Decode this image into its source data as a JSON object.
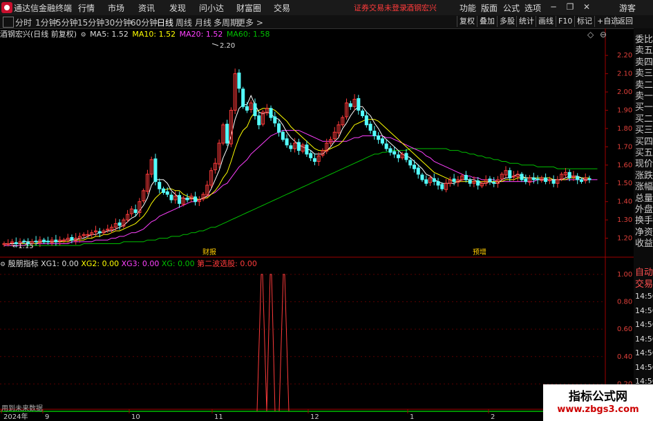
{
  "menubar": {
    "app_name": "通达信金融终端",
    "menus": [
      "行情",
      "市场",
      "资讯",
      "发现",
      "问小达",
      "财富圈",
      "交易"
    ],
    "warning": "证券交易未登录",
    "stock_link": "酒钢宏兴",
    "tools": [
      "功能",
      "版面",
      "公式",
      "选项"
    ],
    "user": "游客"
  },
  "toolbar": {
    "periods": [
      "分时",
      "1分钟",
      "5分钟",
      "15分钟",
      "30分钟",
      "60分钟",
      "日线",
      "周线",
      "月线",
      "多周期",
      "更多 >"
    ],
    "active_period": "日线",
    "right_buttons": [
      "复权",
      "叠加",
      "多股",
      "统计",
      "画线",
      "F10",
      "标记",
      "+自选",
      "返回"
    ]
  },
  "chart_header": {
    "stock": "酒钢宏兴(日线 前复权)",
    "ma5": "MA5: 1.52",
    "ma10": "MA10: 1.52",
    "ma20": "MA20: 1.52",
    "ma60": "MA60: 1.58"
  },
  "indicator_header": {
    "name": "殷朋指标",
    "xg1": "XG1: 0.00",
    "xg2": "XG2: 0.00",
    "xg3": "XG3: 0.00",
    "xg": "XG: 0.00",
    "second": "第二波选股: 0.00"
  },
  "colors": {
    "up": "#ff3b3b",
    "down": "#54ffff",
    "ma5": "#ffffff",
    "ma10": "#ffff00",
    "ma20": "#ff40ff",
    "ma60": "#00c000",
    "grid": "#7a0000"
  },
  "chart_data": {
    "type": "candlestick",
    "y_range": [
      1.1,
      2.28
    ],
    "y_ticks": [
      "2.20",
      "2.10",
      "2.00",
      "1.90",
      "1.80",
      "1.70",
      "1.60",
      "1.50",
      "1.40",
      "1.30",
      "1.20"
    ],
    "high_label": "2.20",
    "low_label": "1.15",
    "x_labels": [
      "2024年",
      "9",
      "10",
      "11",
      "12",
      "1",
      "2"
    ],
    "event_labels": [
      "财报",
      "预增"
    ],
    "indicator_range": [
      0,
      1.05
    ],
    "indicator_ticks": [
      "1.00",
      "0.80",
      "0.60",
      "0.40",
      "0.20"
    ],
    "closes": [
      1.17,
      1.17,
      1.18,
      1.17,
      1.18,
      1.18,
      1.17,
      1.18,
      1.18,
      1.19,
      1.18,
      1.18,
      1.19,
      1.18,
      1.19,
      1.19,
      1.2,
      1.19,
      1.2,
      1.21,
      1.22,
      1.22,
      1.23,
      1.24,
      1.23,
      1.24,
      1.25,
      1.26,
      1.28,
      1.27,
      1.3,
      1.33,
      1.36,
      1.34,
      1.4,
      1.46,
      1.55,
      1.63,
      1.51,
      1.47,
      1.45,
      1.44,
      1.41,
      1.43,
      1.39,
      1.42,
      1.41,
      1.43,
      1.4,
      1.41,
      1.44,
      1.49,
      1.57,
      1.61,
      1.72,
      1.82,
      1.72,
      1.9,
      2.1,
      2.02,
      1.92,
      1.9,
      1.94,
      1.87,
      1.82,
      1.89,
      1.91,
      1.86,
      1.83,
      1.78,
      1.74,
      1.71,
      1.69,
      1.72,
      1.68,
      1.71,
      1.66,
      1.64,
      1.62,
      1.65,
      1.68,
      1.72,
      1.74,
      1.78,
      1.82,
      1.86,
      1.94,
      1.92,
      1.96,
      1.9,
      1.87,
      1.82,
      1.79,
      1.76,
      1.74,
      1.72,
      1.69,
      1.67,
      1.66,
      1.64,
      1.66,
      1.63,
      1.6,
      1.58,
      1.55,
      1.52,
      1.5,
      1.53,
      1.51,
      1.49,
      1.47,
      1.5,
      1.52,
      1.51,
      1.52,
      1.54,
      1.52,
      1.5,
      1.51,
      1.49,
      1.5,
      1.52,
      1.51,
      1.5,
      1.52,
      1.55,
      1.57,
      1.53,
      1.54,
      1.55,
      1.52,
      1.51,
      1.53,
      1.52,
      1.52,
      1.53,
      1.51,
      1.52,
      1.5,
      1.52,
      1.55,
      1.56,
      1.53,
      1.54,
      1.52,
      1.51,
      1.53,
      1.52
    ],
    "ma5": [
      1.17,
      1.17,
      1.17,
      1.17,
      1.17,
      1.18,
      1.18,
      1.18,
      1.18,
      1.18,
      1.18,
      1.18,
      1.18,
      1.18,
      1.18,
      1.19,
      1.19,
      1.19,
      1.19,
      1.2,
      1.2,
      1.21,
      1.22,
      1.22,
      1.23,
      1.23,
      1.24,
      1.24,
      1.25,
      1.26,
      1.27,
      1.29,
      1.31,
      1.32,
      1.35,
      1.38,
      1.42,
      1.49,
      1.52,
      1.52,
      1.52,
      1.5,
      1.46,
      1.44,
      1.42,
      1.42,
      1.41,
      1.42,
      1.41,
      1.41,
      1.42,
      1.43,
      1.47,
      1.52,
      1.57,
      1.64,
      1.69,
      1.76,
      1.85,
      1.91,
      1.93,
      1.93,
      1.98,
      1.93,
      1.89,
      1.88,
      1.89,
      1.88,
      1.86,
      1.85,
      1.82,
      1.78,
      1.75,
      1.73,
      1.71,
      1.7,
      1.69,
      1.68,
      1.66,
      1.66,
      1.66,
      1.68,
      1.7,
      1.73,
      1.75,
      1.8,
      1.83,
      1.87,
      1.9,
      1.92,
      1.92,
      1.89,
      1.87,
      1.83,
      1.8,
      1.76,
      1.74,
      1.72,
      1.7,
      1.68,
      1.66,
      1.65,
      1.64,
      1.62,
      1.6,
      1.58,
      1.55,
      1.54,
      1.52,
      1.51,
      1.5,
      1.5,
      1.5,
      1.5,
      1.51,
      1.52,
      1.52,
      1.52,
      1.52,
      1.51,
      1.5,
      1.5,
      1.51,
      1.5,
      1.5,
      1.52,
      1.53,
      1.53,
      1.54,
      1.55,
      1.54,
      1.53,
      1.53,
      1.53,
      1.52,
      1.52,
      1.52,
      1.52,
      1.52,
      1.52,
      1.52,
      1.53,
      1.54,
      1.54,
      1.54,
      1.53,
      1.52,
      1.52
    ],
    "ma10": [
      1.17,
      1.17,
      1.17,
      1.17,
      1.17,
      1.17,
      1.17,
      1.17,
      1.17,
      1.18,
      1.18,
      1.18,
      1.18,
      1.18,
      1.18,
      1.18,
      1.18,
      1.19,
      1.19,
      1.19,
      1.19,
      1.2,
      1.2,
      1.21,
      1.21,
      1.22,
      1.22,
      1.23,
      1.24,
      1.24,
      1.25,
      1.26,
      1.27,
      1.28,
      1.3,
      1.32,
      1.35,
      1.39,
      1.42,
      1.44,
      1.46,
      1.47,
      1.47,
      1.46,
      1.46,
      1.44,
      1.43,
      1.42,
      1.42,
      1.41,
      1.42,
      1.42,
      1.44,
      1.46,
      1.49,
      1.53,
      1.56,
      1.62,
      1.69,
      1.75,
      1.79,
      1.81,
      1.86,
      1.89,
      1.9,
      1.91,
      1.91,
      1.91,
      1.9,
      1.88,
      1.86,
      1.84,
      1.81,
      1.79,
      1.77,
      1.75,
      1.73,
      1.71,
      1.69,
      1.68,
      1.68,
      1.68,
      1.69,
      1.7,
      1.71,
      1.73,
      1.76,
      1.79,
      1.82,
      1.83,
      1.84,
      1.85,
      1.85,
      1.85,
      1.84,
      1.82,
      1.8,
      1.78,
      1.76,
      1.74,
      1.72,
      1.7,
      1.68,
      1.66,
      1.64,
      1.62,
      1.6,
      1.58,
      1.56,
      1.55,
      1.54,
      1.53,
      1.52,
      1.51,
      1.51,
      1.51,
      1.51,
      1.51,
      1.51,
      1.51,
      1.51,
      1.51,
      1.51,
      1.51,
      1.51,
      1.51,
      1.52,
      1.52,
      1.52,
      1.53,
      1.53,
      1.53,
      1.53,
      1.53,
      1.53,
      1.53,
      1.53,
      1.53,
      1.52,
      1.52,
      1.52,
      1.52,
      1.53,
      1.53,
      1.53,
      1.53,
      1.53,
      1.53
    ],
    "ma20": [
      1.16,
      1.16,
      1.16,
      1.16,
      1.16,
      1.16,
      1.17,
      1.17,
      1.17,
      1.17,
      1.17,
      1.17,
      1.17,
      1.17,
      1.17,
      1.17,
      1.17,
      1.18,
      1.18,
      1.18,
      1.18,
      1.18,
      1.18,
      1.19,
      1.19,
      1.19,
      1.19,
      1.2,
      1.2,
      1.21,
      1.21,
      1.22,
      1.23,
      1.23,
      1.24,
      1.25,
      1.27,
      1.29,
      1.3,
      1.32,
      1.33,
      1.34,
      1.35,
      1.36,
      1.37,
      1.38,
      1.39,
      1.4,
      1.4,
      1.41,
      1.42,
      1.43,
      1.44,
      1.45,
      1.47,
      1.49,
      1.5,
      1.53,
      1.56,
      1.59,
      1.61,
      1.63,
      1.66,
      1.68,
      1.7,
      1.72,
      1.74,
      1.76,
      1.77,
      1.78,
      1.79,
      1.79,
      1.79,
      1.79,
      1.79,
      1.78,
      1.77,
      1.76,
      1.75,
      1.74,
      1.73,
      1.73,
      1.73,
      1.73,
      1.73,
      1.73,
      1.73,
      1.74,
      1.75,
      1.75,
      1.76,
      1.76,
      1.76,
      1.76,
      1.76,
      1.76,
      1.75,
      1.75,
      1.74,
      1.73,
      1.72,
      1.71,
      1.7,
      1.69,
      1.68,
      1.67,
      1.65,
      1.64,
      1.62,
      1.61,
      1.6,
      1.59,
      1.58,
      1.57,
      1.56,
      1.55,
      1.54,
      1.54,
      1.53,
      1.53,
      1.52,
      1.52,
      1.52,
      1.52,
      1.51,
      1.51,
      1.51,
      1.51,
      1.51,
      1.51,
      1.51,
      1.51,
      1.51,
      1.51,
      1.52,
      1.52,
      1.52,
      1.52,
      1.52,
      1.52,
      1.52,
      1.52,
      1.52,
      1.52,
      1.52,
      1.52,
      1.52,
      1.52,
      1.52,
      1.52
    ],
    "ma60": [
      1.16,
      1.16,
      1.16,
      1.16,
      1.16,
      1.16,
      1.16,
      1.16,
      1.16,
      1.16,
      1.16,
      1.16,
      1.16,
      1.16,
      1.16,
      1.16,
      1.16,
      1.16,
      1.16,
      1.16,
      1.17,
      1.17,
      1.17,
      1.17,
      1.17,
      1.17,
      1.17,
      1.17,
      1.17,
      1.17,
      1.18,
      1.18,
      1.18,
      1.18,
      1.18,
      1.18,
      1.19,
      1.19,
      1.19,
      1.2,
      1.2,
      1.2,
      1.21,
      1.21,
      1.21,
      1.22,
      1.22,
      1.23,
      1.23,
      1.24,
      1.24,
      1.25,
      1.26,
      1.26,
      1.27,
      1.28,
      1.29,
      1.3,
      1.31,
      1.32,
      1.33,
      1.34,
      1.35,
      1.36,
      1.37,
      1.38,
      1.39,
      1.4,
      1.41,
      1.42,
      1.43,
      1.44,
      1.45,
      1.46,
      1.47,
      1.48,
      1.49,
      1.5,
      1.51,
      1.52,
      1.53,
      1.54,
      1.55,
      1.56,
      1.57,
      1.58,
      1.59,
      1.6,
      1.61,
      1.62,
      1.63,
      1.64,
      1.65,
      1.66,
      1.66,
      1.67,
      1.67,
      1.68,
      1.68,
      1.68,
      1.68,
      1.68,
      1.69,
      1.69,
      1.69,
      1.69,
      1.69,
      1.69,
      1.69,
      1.69,
      1.69,
      1.69,
      1.68,
      1.68,
      1.68,
      1.67,
      1.67,
      1.66,
      1.66,
      1.65,
      1.65,
      1.64,
      1.64,
      1.63,
      1.63,
      1.62,
      1.62,
      1.61,
      1.61,
      1.61,
      1.6,
      1.6,
      1.6,
      1.6,
      1.59,
      1.59,
      1.59,
      1.59,
      1.59,
      1.58,
      1.58,
      1.58,
      1.58,
      1.58,
      1.58,
      1.58,
      1.58,
      1.58,
      1.58,
      1.58
    ]
  },
  "sidebar": {
    "quote_items": [
      "委比",
      "卖五",
      "卖四",
      "卖三",
      "卖二",
      "卖一",
      "买一",
      "买二",
      "买三",
      "买四",
      "买五",
      "现价",
      "涨跌",
      "涨幅",
      "总量",
      "外盘",
      "换手",
      "净资",
      "收益"
    ],
    "trade_items": [
      "自动",
      "交易"
    ],
    "times": [
      "14:56",
      "14:56",
      "14:56",
      "14:56",
      "14:56",
      "14:56",
      "14:56",
      "14:56"
    ]
  },
  "footer_note": "用到未来数据",
  "watermark": {
    "title": "指标公式网",
    "url": "www.zbgs3.com"
  }
}
